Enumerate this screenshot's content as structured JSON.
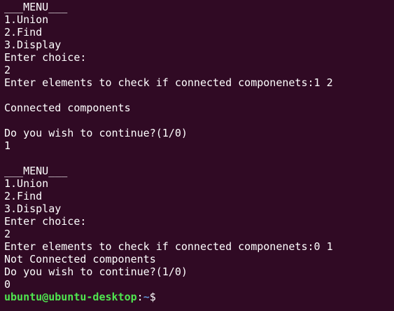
{
  "terminal": {
    "lines": [
      "___MENU___",
      "1.Union",
      "2.Find",
      "3.Display",
      "Enter choice:",
      "2",
      "Enter elements to check if connected componenets:1 2",
      "",
      "Connected components",
      "",
      "Do you wish to continue?(1/0)",
      "1",
      "",
      "___MENU___",
      "1.Union",
      "2.Find",
      "3.Display",
      "Enter choice:",
      "2",
      "Enter elements to check if connected componenets:0 1",
      "Not Connected components",
      "Do you wish to continue?(1/0)",
      "0"
    ],
    "prompt": {
      "user_host": "ubuntu@ubuntu-desktop",
      "separator": ":",
      "path": "~",
      "symbol": "$ "
    }
  },
  "colors": {
    "background": "#300a24",
    "text": "#ffffff",
    "prompt_user": "#4fe64f",
    "prompt_path": "#5f8fd0"
  }
}
